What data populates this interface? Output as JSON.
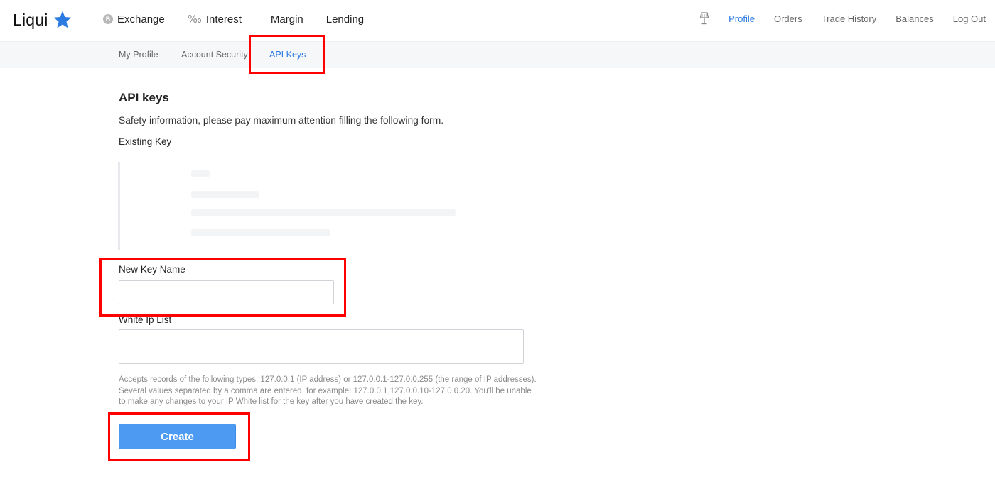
{
  "header": {
    "logo_text": "Liqui",
    "main_nav": [
      {
        "label": "Exchange",
        "icon": "coin-icon"
      },
      {
        "label": "Interest",
        "icon": "permille-icon"
      },
      {
        "label": "Margin",
        "icon": ""
      },
      {
        "label": "Lending",
        "icon": ""
      }
    ],
    "coin_glyph": "B",
    "permille_glyph": "‰",
    "right_nav": [
      {
        "label": "Profile",
        "active": true
      },
      {
        "label": "Orders",
        "active": false
      },
      {
        "label": "Trade History",
        "active": false
      },
      {
        "label": "Balances",
        "active": false
      },
      {
        "label": "Log Out",
        "active": false
      }
    ]
  },
  "subnav": {
    "items": [
      {
        "label": "My Profile",
        "active": false
      },
      {
        "label": "Account Security",
        "active": false
      },
      {
        "label": "API Keys",
        "active": true
      }
    ]
  },
  "page": {
    "title": "API keys",
    "safety_text": "Safety information, please pay maximum attention filling the following form.",
    "existing_key_label": "Existing Key",
    "new_key_name_label": "New Key Name",
    "new_key_name_value": "",
    "white_ip_label": "White Ip List",
    "white_ip_value": "",
    "help_text": "Accepts records of the following types: 127.0.0.1 (IP address) or 127.0.0.1-127.0.0.255 (the range of IP addresses). Several values separated by a comma are entered, for example: 127.0.0.1,127.0.0.10-127.0.0.20. You'll be unable to make any changes to your IP White list for the key after you have created the key.",
    "create_label": "Create"
  },
  "colors": {
    "accent": "#2a7ae2",
    "button": "#4d9af3",
    "highlight": "#ff0000",
    "logo_star": "#2a7ae2"
  }
}
